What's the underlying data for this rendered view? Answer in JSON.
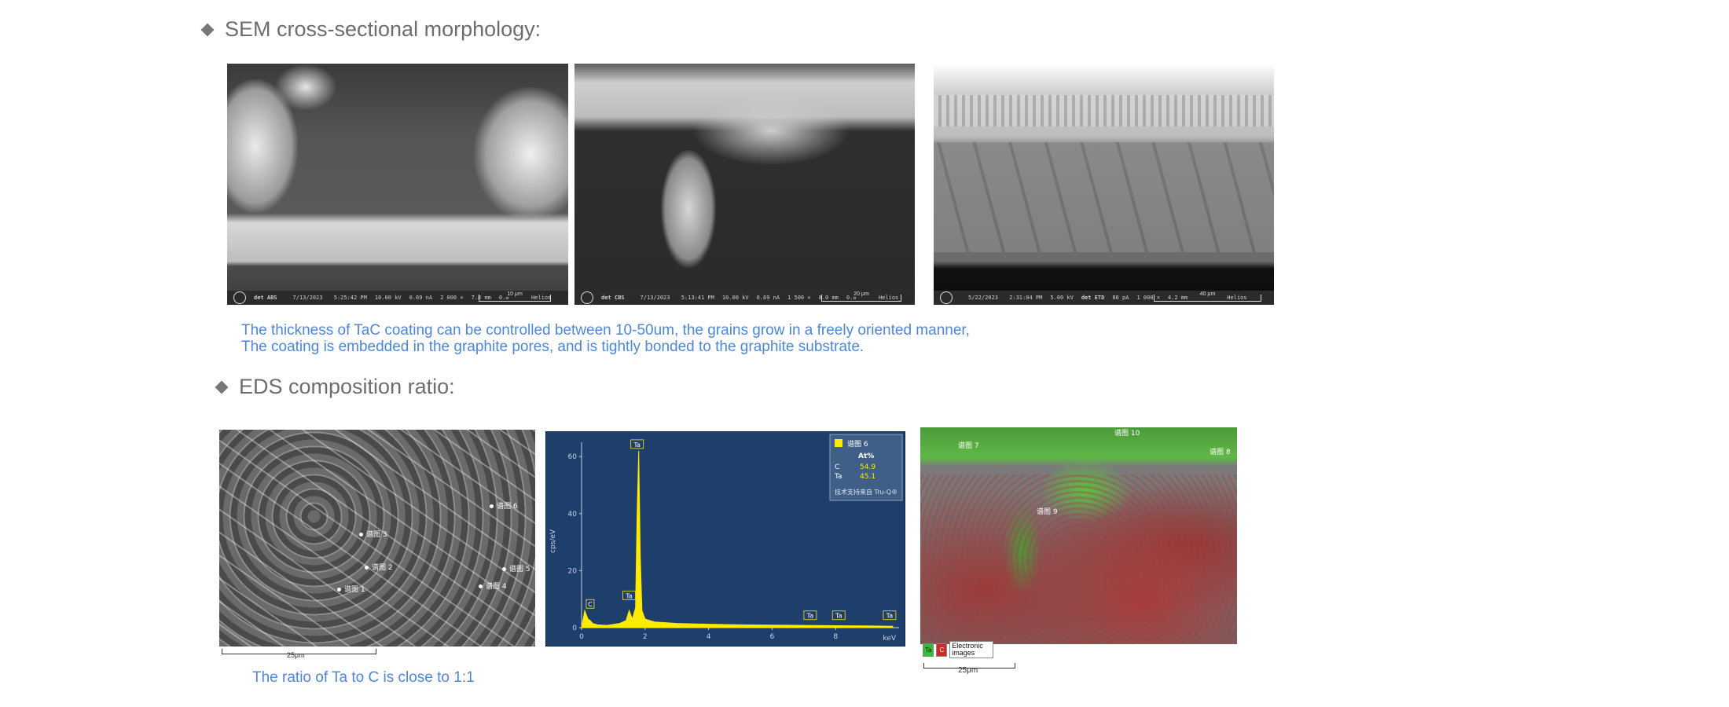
{
  "sections": {
    "sem_heading": "SEM cross-sectional morphology:",
    "sem_caption_line1": "The thickness of TaC coating can be controlled between 10-50um, the grains grow in a freely oriented manner,",
    "sem_caption_line2": "The coating is embedded in the graphite pores, and is tightly bonded to the graphite substrate.",
    "eds_heading": "EDS composition ratio:",
    "eds_caption": "The ratio of Ta to C is close to 1:1"
  },
  "sem_images": [
    {
      "det_label": "det",
      "det": "ABS",
      "date": "7/13/2023",
      "time": "5:25:42 PM",
      "hv": "10.00 kV",
      "curr": "0.69 nA",
      "mag": "2 000 ×",
      "wd": "7.8 mm",
      "tilt": "0.0 °",
      "scale": "10 μm",
      "brand": "Helios"
    },
    {
      "det_label": "det",
      "det": "CBS",
      "date": "7/13/2023",
      "time": "5:13:41 PM",
      "hv": "10.00 kV",
      "curr": "0.69 nA",
      "mag": "1 500 ×",
      "wd": "8.0 mm",
      "tilt": "0.0 °",
      "scale": "20 μm",
      "brand": "Helios"
    },
    {
      "det_label": "det",
      "det": "ETD",
      "date": "5/22/2023",
      "time": "2:31:04 PM",
      "hv": "5.00 kV",
      "curr": "86 pA",
      "mag": "1 000 ×",
      "wd": "4.2 mm",
      "tilt": "",
      "scale": "40 μm",
      "brand": "Helios"
    }
  ],
  "eds_sem": {
    "scale": "25μm",
    "spots": [
      "谱图 1",
      "谱图 2",
      "谱图 3",
      "谱图 4",
      "谱图 5",
      "谱图 6"
    ]
  },
  "chart_data": {
    "type": "line",
    "title": "",
    "xlabel": "keV",
    "ylabel": "cps/eV",
    "xlim": [
      0,
      10
    ],
    "ylim": [
      0,
      65
    ],
    "xticks": [
      0,
      2,
      4,
      6,
      8
    ],
    "yticks": [
      0,
      20,
      40,
      60
    ],
    "series": [
      {
        "name": "谱图 6",
        "x": [
          0,
          0.1,
          0.2,
          0.27,
          0.35,
          0.5,
          0.8,
          1.2,
          1.4,
          1.5,
          1.6,
          1.7,
          1.75,
          1.8,
          1.85,
          1.9,
          2.0,
          2.3,
          2.6,
          3.0,
          4.0,
          5.0,
          6.0,
          7.0,
          8.0,
          9.0,
          9.8
        ],
        "y": [
          0,
          6,
          3,
          2.5,
          1.5,
          1.0,
          0.8,
          1.5,
          2.5,
          6,
          3,
          7,
          40,
          62,
          25,
          6,
          3,
          2,
          1.8,
          1.5,
          1.2,
          1.0,
          0.9,
          0.8,
          0.7,
          0.6,
          0.5
        ]
      }
    ],
    "peak_labels": [
      {
        "label": "C",
        "x": 0.27,
        "y": 6
      },
      {
        "label": "Ta",
        "x": 1.5,
        "y": 9
      },
      {
        "label": "Ta",
        "x": 1.75,
        "y": 62
      },
      {
        "label": "Ta",
        "x": 7.2,
        "y": 2
      },
      {
        "label": "Ta",
        "x": 8.1,
        "y": 2
      },
      {
        "label": "Ta",
        "x": 9.7,
        "y": 2
      }
    ],
    "legend": {
      "title": "谱图 6",
      "header": "At%",
      "rows": [
        {
          "el": "C",
          "val": "54.9"
        },
        {
          "el": "Ta",
          "val": "45.1"
        }
      ],
      "note": "技术支持来自 Tru-Q®",
      "color": "#ffea00"
    },
    "colors": {
      "background": "#1e3f6b",
      "series": "#ffea00"
    }
  },
  "eds_map": {
    "spots": [
      "谱图 7",
      "谱图 8",
      "谱图 9",
      "谱图 10"
    ],
    "legend": {
      "ta": "Ta",
      "c": "C",
      "label": "Electronic images"
    },
    "scale": "25μm"
  }
}
